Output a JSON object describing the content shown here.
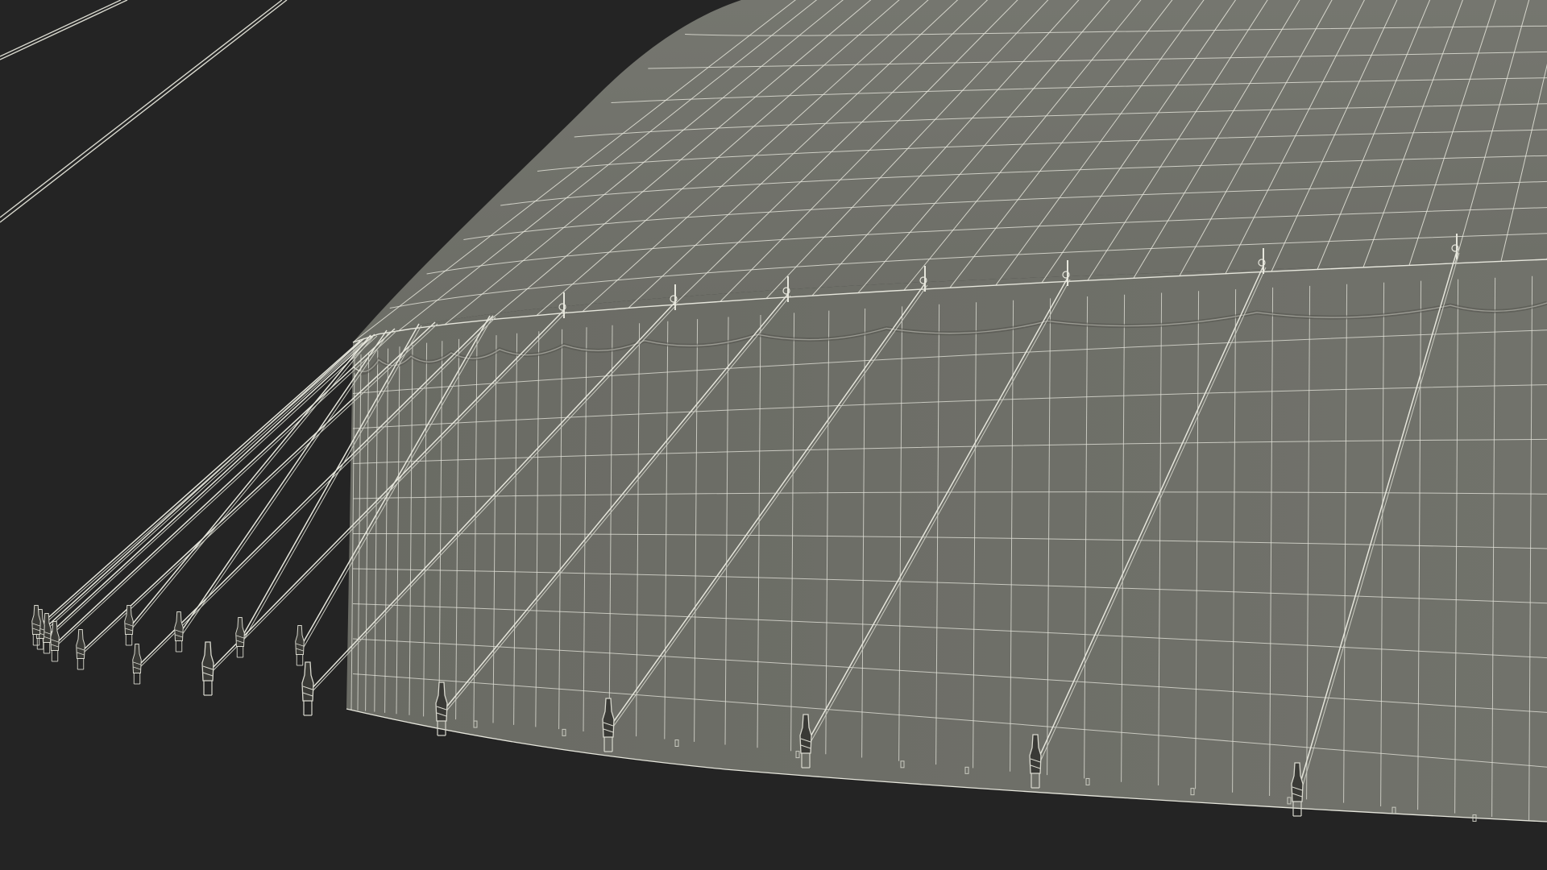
{
  "scene": {
    "subject": "tent-wireframe",
    "colors": {
      "background": "#242424",
      "surface": "#6e6f68",
      "surface_shadow": "#5f605a",
      "wire": "#e6e6dc",
      "wire_dim": "#c9cac0",
      "stake": "#d8d8ce"
    },
    "icons": [
      "stake-icon",
      "pole-icon",
      "guy-rope-icon"
    ]
  }
}
